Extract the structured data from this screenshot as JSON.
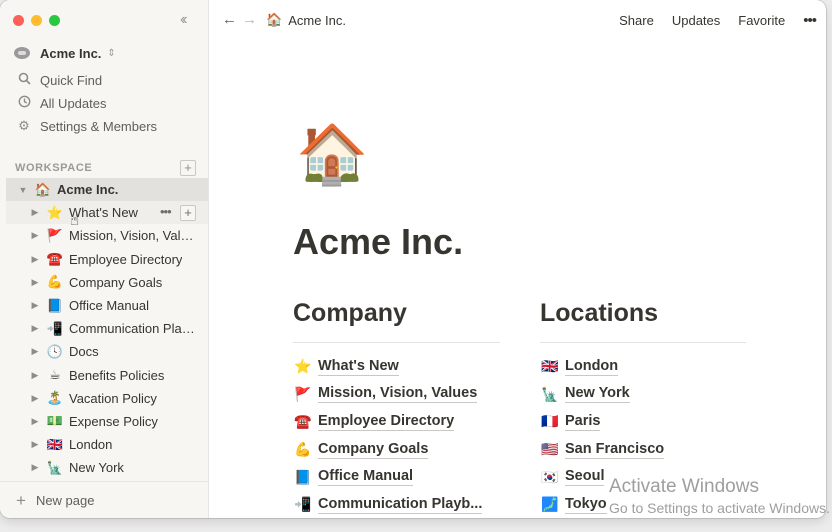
{
  "sidebar": {
    "workspace_name": "Acme Inc.",
    "workspace_caret": "⌃⌄",
    "nav": [
      {
        "label": "Quick Find",
        "icon": "search-icon"
      },
      {
        "label": "All Updates",
        "icon": "clock-icon"
      },
      {
        "label": "Settings & Members",
        "icon": "gear-icon"
      }
    ],
    "section_label": "WORKSPACE",
    "root": {
      "emoji": "🏠",
      "label": "Acme Inc."
    },
    "items": [
      {
        "emoji": "⭐",
        "label": "What's New"
      },
      {
        "emoji": "🚩",
        "label": "Mission, Vision, Values"
      },
      {
        "emoji": "☎️",
        "label": "Employee Directory"
      },
      {
        "emoji": "💪",
        "label": "Company Goals"
      },
      {
        "emoji": "📘",
        "label": "Office Manual"
      },
      {
        "emoji": "📲",
        "label": "Communication Playbook"
      },
      {
        "emoji": "🕓",
        "label": "Docs"
      },
      {
        "emoji": "☕",
        "label": "Benefits Policies"
      },
      {
        "emoji": "🏝️",
        "label": "Vacation Policy"
      },
      {
        "emoji": "💵",
        "label": "Expense Policy"
      },
      {
        "emoji": "🇬🇧",
        "label": "London"
      },
      {
        "emoji": "🗽",
        "label": "New York"
      }
    ],
    "new_page_label": "New page"
  },
  "topbar": {
    "breadcrumb_emoji": "🏠",
    "breadcrumb": "Acme Inc.",
    "share": "Share",
    "updates": "Updates",
    "favorite": "Favorite",
    "more": "•••"
  },
  "page": {
    "icon": "🏠",
    "title": "Acme Inc.",
    "company": {
      "heading": "Company",
      "links": [
        {
          "emoji": "⭐",
          "label": "What's New"
        },
        {
          "emoji": "🚩",
          "label": "Mission, Vision, Values"
        },
        {
          "emoji": "☎️",
          "label": "Employee Directory"
        },
        {
          "emoji": "💪",
          "label": "Company Goals"
        },
        {
          "emoji": "📘",
          "label": "Office Manual"
        },
        {
          "emoji": "📲",
          "label": "Communication Playb..."
        }
      ]
    },
    "locations": {
      "heading": "Locations",
      "links": [
        {
          "emoji": "🇬🇧",
          "label": "London"
        },
        {
          "emoji": "🗽",
          "label": "New York"
        },
        {
          "emoji": "🇫🇷",
          "label": "Paris"
        },
        {
          "emoji": "🇺🇸",
          "label": "San Francisco"
        },
        {
          "emoji": "🇰🇷",
          "label": "Seoul"
        },
        {
          "emoji": "🗾",
          "label": "Tokyo"
        }
      ]
    }
  },
  "watermark": {
    "line1": "Activate Windows",
    "line2": "Go to Settings to activate Windows."
  }
}
